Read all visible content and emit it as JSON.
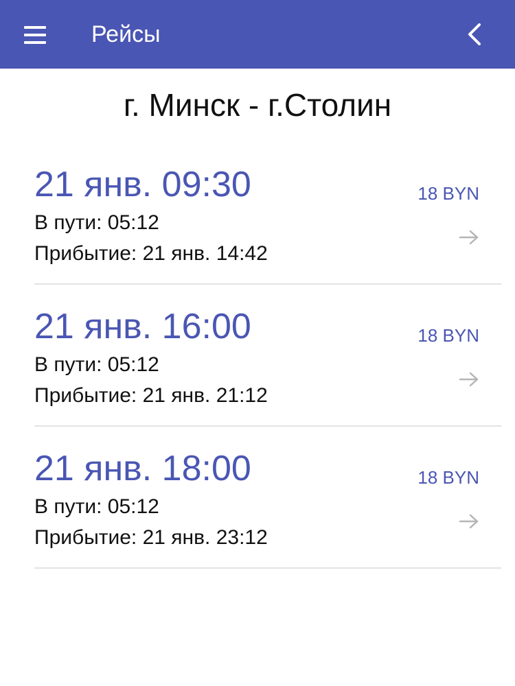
{
  "app_bar": {
    "title": "Рейсы",
    "menu_icon": "hamburger-menu-icon",
    "back_icon": "chevron-left-icon",
    "color": "#4a56b3"
  },
  "route": {
    "title": "г. Минск - г.Столин"
  },
  "trips": [
    {
      "departure": "21 янв. 09:30",
      "duration": "В пути: 05:12",
      "arrival": "Прибытие: 21 янв. 14:42",
      "price": "18 BYN"
    },
    {
      "departure": "21 янв. 16:00",
      "duration": "В пути: 05:12",
      "arrival": "Прибытие: 21 янв. 21:12",
      "price": "18 BYN"
    },
    {
      "departure": "21 янв. 18:00",
      "duration": "В пути: 05:12",
      "arrival": "Прибытие: 21 янв. 23:12",
      "price": "18 BYN"
    }
  ]
}
